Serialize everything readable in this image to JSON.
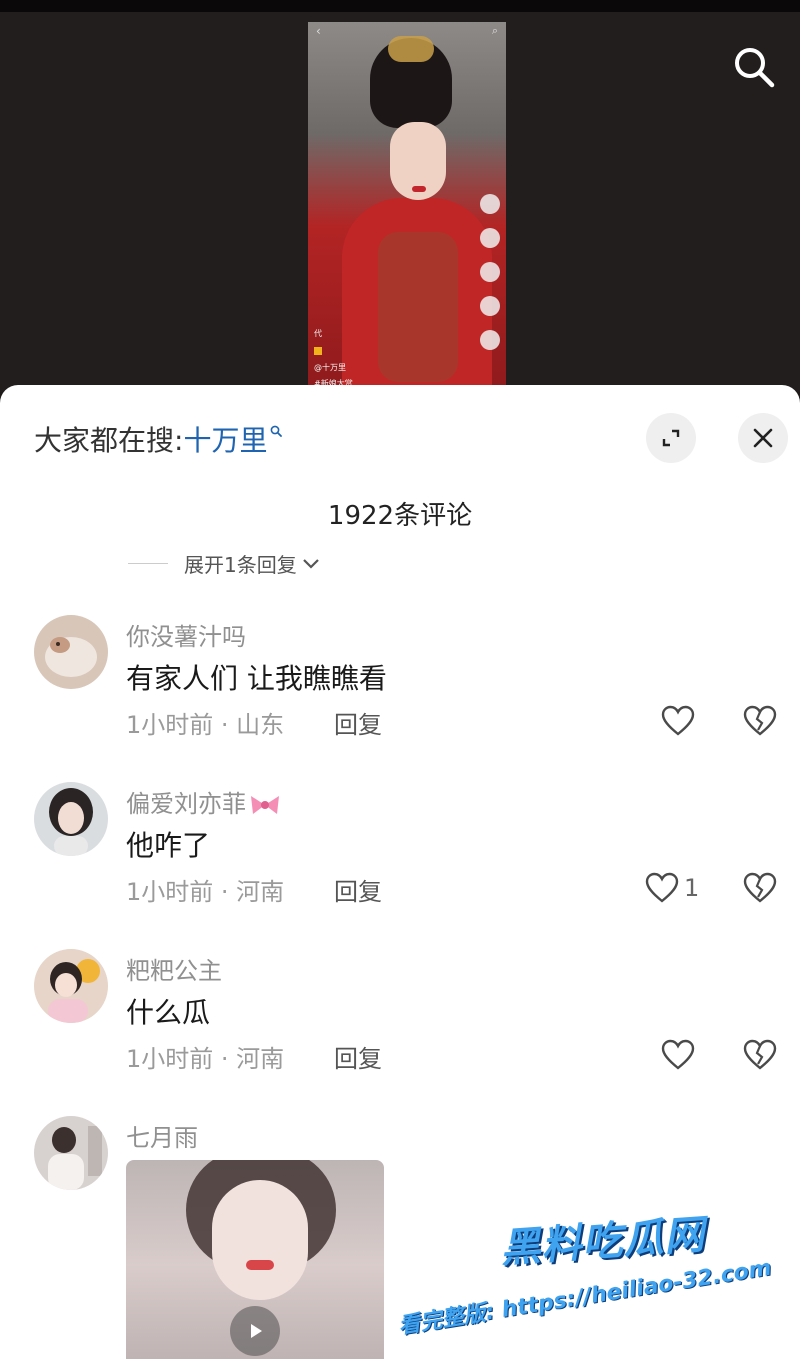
{
  "search_overlay": {
    "prefix": "大家都在搜:",
    "term": "十万里"
  },
  "comments_header": {
    "count_label": "1922条评论",
    "expand_replies_label": "展开1条回复"
  },
  "comments": [
    {
      "username": "你没薯汁吗",
      "text": "有家人们 让我瞧瞧看",
      "time_location": "1小时前 · 山东",
      "reply_label": "回复",
      "like_count": ""
    },
    {
      "username": "偏爱刘亦菲",
      "text": "他咋了",
      "time_location": "1小时前 · 河南",
      "reply_label": "回复",
      "like_count": "1"
    },
    {
      "username": "粑粑公主",
      "text": "什么瓜",
      "time_location": "1小时前 · 河南",
      "reply_label": "回复",
      "like_count": ""
    },
    {
      "username": "七月雨"
    }
  ],
  "video_preview": {
    "info_line_1": "代",
    "info_line_2": "@十万里",
    "info_line_3": "#新娘大赏"
  },
  "watermark": {
    "title": "黑料吃瓜网",
    "url_line": "看完整版: https://heiliao-32.com"
  },
  "colors": {
    "search_term": "#1f64b0",
    "sheet_background": "#ffffff",
    "backdrop": "#1e1a1a",
    "watermark": "#3fa3f0"
  },
  "icons": [
    "search-icon",
    "expand-icon",
    "close-icon",
    "heart-icon",
    "broken-heart-icon",
    "chevron-down-icon",
    "play-icon",
    "bow-emoji-icon"
  ]
}
